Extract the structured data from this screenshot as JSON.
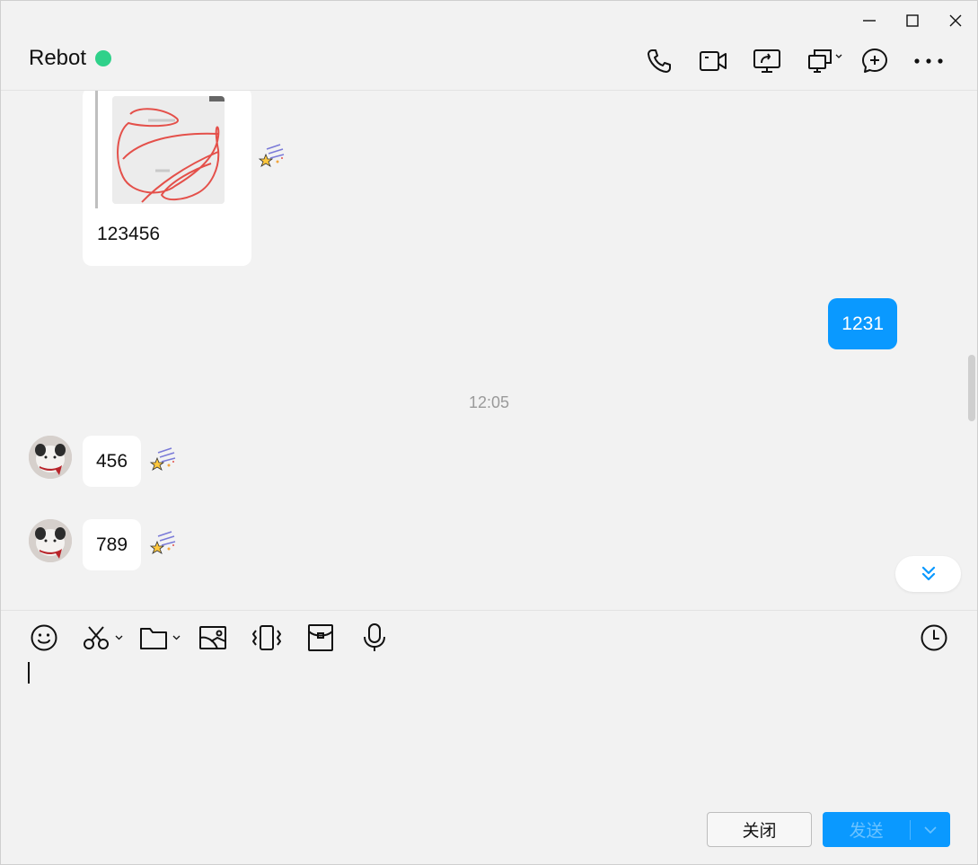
{
  "header": {
    "title": "Rebot",
    "status_color": "#2fd18a"
  },
  "window_controls": [
    "minimize-icon",
    "maximize-icon",
    "close-icon"
  ],
  "toolbar_icons": [
    "phone-icon",
    "video-call-icon",
    "screen-share-icon",
    "remote-desktop-icon",
    "add-chat-icon",
    "more-icon"
  ],
  "messages": {
    "quote_text": "123456",
    "outgoing_1": "1231",
    "timestamp": "12:05",
    "incoming_1": "456",
    "incoming_2": "789"
  },
  "composer": {
    "tools": [
      "emoji-icon",
      "screenshot-icon",
      "folder-icon",
      "image-icon",
      "shake-icon",
      "red-packet-icon",
      "voice-icon"
    ],
    "input_value": "",
    "close_label": "关闭",
    "send_label": "发送"
  },
  "colors": {
    "accent": "#0a99ff",
    "background": "#f2f2f2"
  }
}
